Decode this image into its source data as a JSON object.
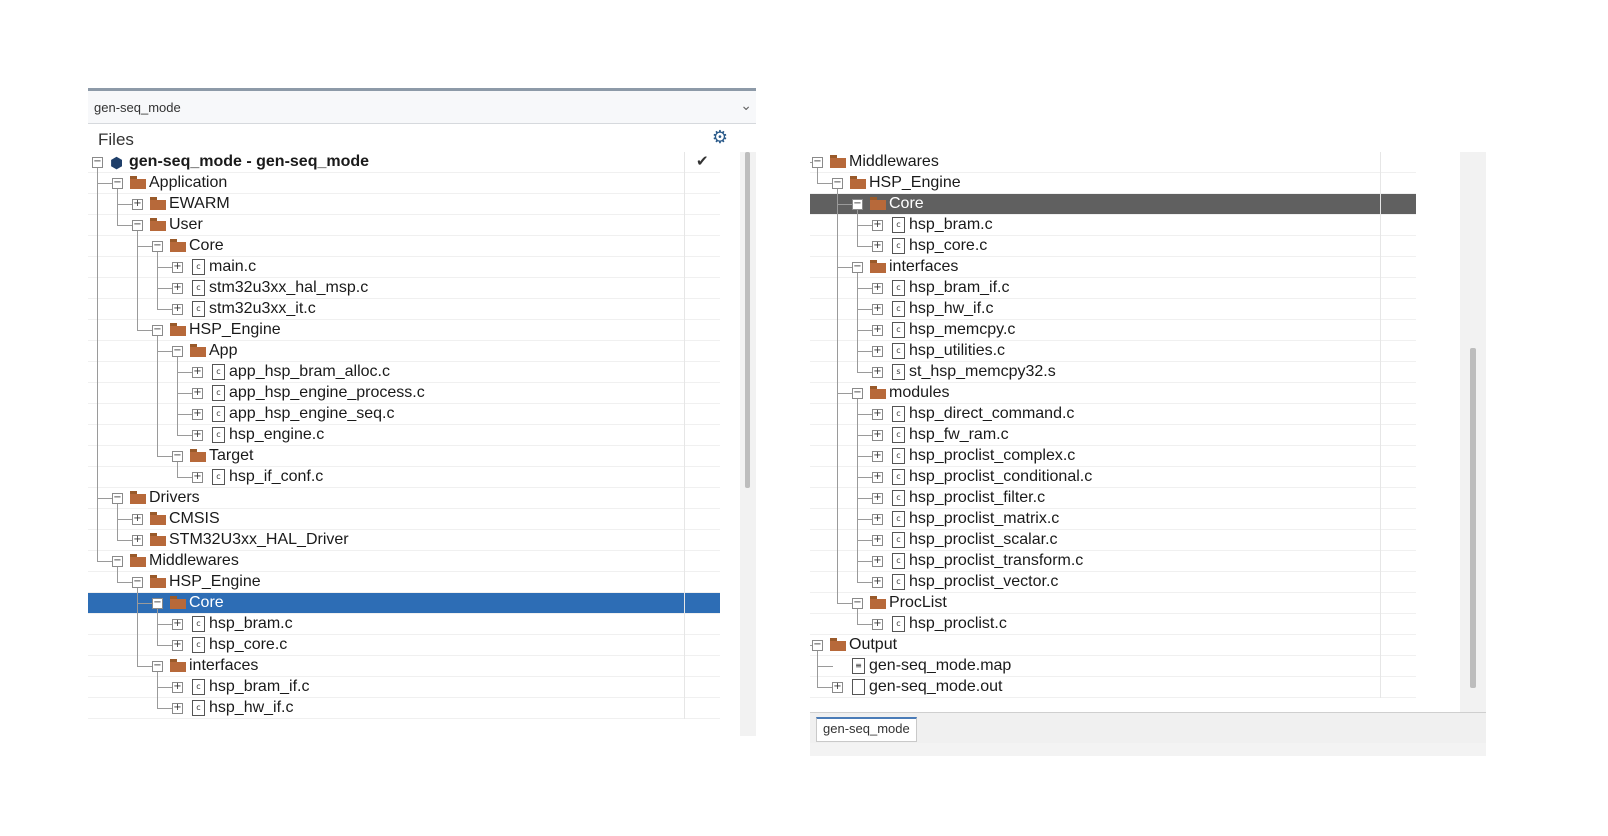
{
  "left": {
    "config": "gen-seq_mode",
    "files_title": "Files",
    "rows": [
      {
        "label": "gen-seq_mode - gen-seq_mode",
        "type": "project",
        "depth": 0,
        "exp": "minus",
        "bold": true,
        "check": "✔"
      },
      {
        "label": "Application",
        "type": "folder",
        "depth": 1,
        "exp": "minus"
      },
      {
        "label": "EWARM",
        "type": "folder",
        "depth": 2,
        "exp": "plus"
      },
      {
        "label": "User",
        "type": "folder",
        "depth": 2,
        "exp": "minus"
      },
      {
        "label": "Core",
        "type": "folder",
        "depth": 3,
        "exp": "minus"
      },
      {
        "label": "main.c",
        "type": "file",
        "depth": 4,
        "exp": "plus"
      },
      {
        "label": "stm32u3xx_hal_msp.c",
        "type": "file",
        "depth": 4,
        "exp": "plus"
      },
      {
        "label": "stm32u3xx_it.c",
        "type": "file",
        "depth": 4,
        "exp": "plus"
      },
      {
        "label": "HSP_Engine",
        "type": "folder",
        "depth": 3,
        "exp": "minus"
      },
      {
        "label": "App",
        "type": "folder",
        "depth": 4,
        "exp": "minus"
      },
      {
        "label": "app_hsp_bram_alloc.c",
        "type": "file",
        "depth": 5,
        "exp": "plus"
      },
      {
        "label": "app_hsp_engine_process.c",
        "type": "file",
        "depth": 5,
        "exp": "plus"
      },
      {
        "label": "app_hsp_engine_seq.c",
        "type": "file",
        "depth": 5,
        "exp": "plus"
      },
      {
        "label": "hsp_engine.c",
        "type": "file",
        "depth": 5,
        "exp": "plus"
      },
      {
        "label": "Target",
        "type": "folder",
        "depth": 4,
        "exp": "minus"
      },
      {
        "label": "hsp_if_conf.c",
        "type": "file",
        "depth": 5,
        "exp": "plus"
      },
      {
        "label": "Drivers",
        "type": "folder",
        "depth": 1,
        "exp": "minus"
      },
      {
        "label": "CMSIS",
        "type": "folder",
        "depth": 2,
        "exp": "plus"
      },
      {
        "label": "STM32U3xx_HAL_Driver",
        "type": "folder",
        "depth": 2,
        "exp": "plus"
      },
      {
        "label": "Middlewares",
        "type": "folder",
        "depth": 1,
        "exp": "minus"
      },
      {
        "label": "HSP_Engine",
        "type": "folder",
        "depth": 2,
        "exp": "minus"
      },
      {
        "label": "Core",
        "type": "folder",
        "depth": 3,
        "exp": "minus",
        "selected": "blue"
      },
      {
        "label": "hsp_bram.c",
        "type": "file",
        "depth": 4,
        "exp": "plus"
      },
      {
        "label": "hsp_core.c",
        "type": "file",
        "depth": 4,
        "exp": "plus"
      },
      {
        "label": "interfaces",
        "type": "folder",
        "depth": 3,
        "exp": "minus"
      },
      {
        "label": "hsp_bram_if.c",
        "type": "file",
        "depth": 4,
        "exp": "plus"
      },
      {
        "label": "hsp_hw_if.c",
        "type": "file",
        "depth": 4,
        "exp": "plus"
      }
    ]
  },
  "right": {
    "bottom_tab": "gen-seq_mode",
    "rows": [
      {
        "label": "Middlewares",
        "type": "folder",
        "depth": 1,
        "exp": "minus"
      },
      {
        "label": "HSP_Engine",
        "type": "folder",
        "depth": 2,
        "exp": "minus"
      },
      {
        "label": "Core",
        "type": "folder",
        "depth": 3,
        "exp": "minus",
        "selected": "gray"
      },
      {
        "label": "hsp_bram.c",
        "type": "file",
        "depth": 4,
        "exp": "plus"
      },
      {
        "label": "hsp_core.c",
        "type": "file",
        "depth": 4,
        "exp": "plus"
      },
      {
        "label": "interfaces",
        "type": "folder",
        "depth": 3,
        "exp": "minus"
      },
      {
        "label": "hsp_bram_if.c",
        "type": "file",
        "depth": 4,
        "exp": "plus"
      },
      {
        "label": "hsp_hw_if.c",
        "type": "file",
        "depth": 4,
        "exp": "plus"
      },
      {
        "label": "hsp_memcpy.c",
        "type": "file",
        "depth": 4,
        "exp": "plus"
      },
      {
        "label": "hsp_utilities.c",
        "type": "file",
        "depth": 4,
        "exp": "plus"
      },
      {
        "label": "st_hsp_memcpy32.s",
        "type": "asm",
        "depth": 4,
        "exp": "plus"
      },
      {
        "label": "modules",
        "type": "folder",
        "depth": 3,
        "exp": "minus"
      },
      {
        "label": "hsp_direct_command.c",
        "type": "file",
        "depth": 4,
        "exp": "plus"
      },
      {
        "label": "hsp_fw_ram.c",
        "type": "file",
        "depth": 4,
        "exp": "plus"
      },
      {
        "label": "hsp_proclist_complex.c",
        "type": "file",
        "depth": 4,
        "exp": "plus"
      },
      {
        "label": "hsp_proclist_conditional.c",
        "type": "file",
        "depth": 4,
        "exp": "plus"
      },
      {
        "label": "hsp_proclist_filter.c",
        "type": "file",
        "depth": 4,
        "exp": "plus"
      },
      {
        "label": "hsp_proclist_matrix.c",
        "type": "file",
        "depth": 4,
        "exp": "plus"
      },
      {
        "label": "hsp_proclist_scalar.c",
        "type": "file",
        "depth": 4,
        "exp": "plus"
      },
      {
        "label": "hsp_proclist_transform.c",
        "type": "file",
        "depth": 4,
        "exp": "plus"
      },
      {
        "label": "hsp_proclist_vector.c",
        "type": "file",
        "depth": 4,
        "exp": "plus"
      },
      {
        "label": "ProcList",
        "type": "folder",
        "depth": 3,
        "exp": "minus"
      },
      {
        "label": "hsp_proclist.c",
        "type": "file",
        "depth": 4,
        "exp": "plus"
      },
      {
        "label": "Output",
        "type": "folder",
        "depth": 1,
        "exp": "minus"
      },
      {
        "label": "gen-seq_mode.map",
        "type": "doc",
        "depth": 2,
        "exp": "none"
      },
      {
        "label": "gen-seq_mode.out",
        "type": "page",
        "depth": 2,
        "exp": "plus"
      }
    ]
  }
}
